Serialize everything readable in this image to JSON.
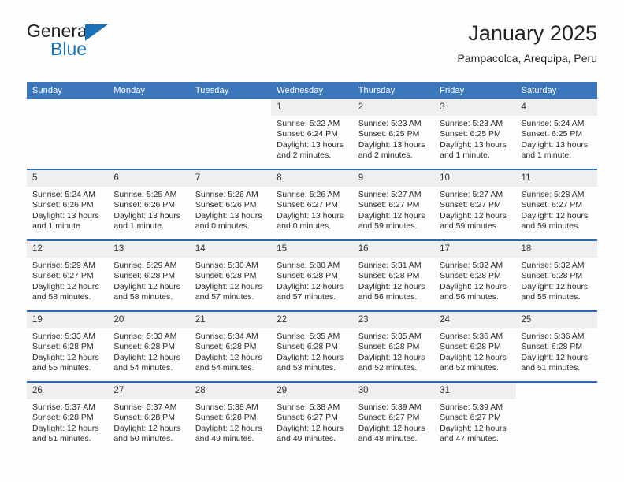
{
  "logo": {
    "word_top": "General",
    "word_bottom": "Blue",
    "accent_color": "#1a72b8"
  },
  "header": {
    "title": "January 2025",
    "subtitle": "Pampacolca, Arequipa, Peru"
  },
  "theme": {
    "header_bg": "#3c76bb",
    "row_divider": "#2c6ab0",
    "daynum_bg": "#efefef",
    "page_bg": "#fefefe"
  },
  "weekday_headers": [
    "Sunday",
    "Monday",
    "Tuesday",
    "Wednesday",
    "Thursday",
    "Friday",
    "Saturday"
  ],
  "weeks": [
    [
      {
        "day": "",
        "sunrise": "",
        "sunset": "",
        "daylight": ""
      },
      {
        "day": "",
        "sunrise": "",
        "sunset": "",
        "daylight": ""
      },
      {
        "day": "",
        "sunrise": "",
        "sunset": "",
        "daylight": ""
      },
      {
        "day": "1",
        "sunrise": "Sunrise: 5:22 AM",
        "sunset": "Sunset: 6:24 PM",
        "daylight": "Daylight: 13 hours and 2 minutes."
      },
      {
        "day": "2",
        "sunrise": "Sunrise: 5:23 AM",
        "sunset": "Sunset: 6:25 PM",
        "daylight": "Daylight: 13 hours and 2 minutes."
      },
      {
        "day": "3",
        "sunrise": "Sunrise: 5:23 AM",
        "sunset": "Sunset: 6:25 PM",
        "daylight": "Daylight: 13 hours and 1 minute."
      },
      {
        "day": "4",
        "sunrise": "Sunrise: 5:24 AM",
        "sunset": "Sunset: 6:25 PM",
        "daylight": "Daylight: 13 hours and 1 minute."
      }
    ],
    [
      {
        "day": "5",
        "sunrise": "Sunrise: 5:24 AM",
        "sunset": "Sunset: 6:26 PM",
        "daylight": "Daylight: 13 hours and 1 minute."
      },
      {
        "day": "6",
        "sunrise": "Sunrise: 5:25 AM",
        "sunset": "Sunset: 6:26 PM",
        "daylight": "Daylight: 13 hours and 1 minute."
      },
      {
        "day": "7",
        "sunrise": "Sunrise: 5:26 AM",
        "sunset": "Sunset: 6:26 PM",
        "daylight": "Daylight: 13 hours and 0 minutes."
      },
      {
        "day": "8",
        "sunrise": "Sunrise: 5:26 AM",
        "sunset": "Sunset: 6:27 PM",
        "daylight": "Daylight: 13 hours and 0 minutes."
      },
      {
        "day": "9",
        "sunrise": "Sunrise: 5:27 AM",
        "sunset": "Sunset: 6:27 PM",
        "daylight": "Daylight: 12 hours and 59 minutes."
      },
      {
        "day": "10",
        "sunrise": "Sunrise: 5:27 AM",
        "sunset": "Sunset: 6:27 PM",
        "daylight": "Daylight: 12 hours and 59 minutes."
      },
      {
        "day": "11",
        "sunrise": "Sunrise: 5:28 AM",
        "sunset": "Sunset: 6:27 PM",
        "daylight": "Daylight: 12 hours and 59 minutes."
      }
    ],
    [
      {
        "day": "12",
        "sunrise": "Sunrise: 5:29 AM",
        "sunset": "Sunset: 6:27 PM",
        "daylight": "Daylight: 12 hours and 58 minutes."
      },
      {
        "day": "13",
        "sunrise": "Sunrise: 5:29 AM",
        "sunset": "Sunset: 6:28 PM",
        "daylight": "Daylight: 12 hours and 58 minutes."
      },
      {
        "day": "14",
        "sunrise": "Sunrise: 5:30 AM",
        "sunset": "Sunset: 6:28 PM",
        "daylight": "Daylight: 12 hours and 57 minutes."
      },
      {
        "day": "15",
        "sunrise": "Sunrise: 5:30 AM",
        "sunset": "Sunset: 6:28 PM",
        "daylight": "Daylight: 12 hours and 57 minutes."
      },
      {
        "day": "16",
        "sunrise": "Sunrise: 5:31 AM",
        "sunset": "Sunset: 6:28 PM",
        "daylight": "Daylight: 12 hours and 56 minutes."
      },
      {
        "day": "17",
        "sunrise": "Sunrise: 5:32 AM",
        "sunset": "Sunset: 6:28 PM",
        "daylight": "Daylight: 12 hours and 56 minutes."
      },
      {
        "day": "18",
        "sunrise": "Sunrise: 5:32 AM",
        "sunset": "Sunset: 6:28 PM",
        "daylight": "Daylight: 12 hours and 55 minutes."
      }
    ],
    [
      {
        "day": "19",
        "sunrise": "Sunrise: 5:33 AM",
        "sunset": "Sunset: 6:28 PM",
        "daylight": "Daylight: 12 hours and 55 minutes."
      },
      {
        "day": "20",
        "sunrise": "Sunrise: 5:33 AM",
        "sunset": "Sunset: 6:28 PM",
        "daylight": "Daylight: 12 hours and 54 minutes."
      },
      {
        "day": "21",
        "sunrise": "Sunrise: 5:34 AM",
        "sunset": "Sunset: 6:28 PM",
        "daylight": "Daylight: 12 hours and 54 minutes."
      },
      {
        "day": "22",
        "sunrise": "Sunrise: 5:35 AM",
        "sunset": "Sunset: 6:28 PM",
        "daylight": "Daylight: 12 hours and 53 minutes."
      },
      {
        "day": "23",
        "sunrise": "Sunrise: 5:35 AM",
        "sunset": "Sunset: 6:28 PM",
        "daylight": "Daylight: 12 hours and 52 minutes."
      },
      {
        "day": "24",
        "sunrise": "Sunrise: 5:36 AM",
        "sunset": "Sunset: 6:28 PM",
        "daylight": "Daylight: 12 hours and 52 minutes."
      },
      {
        "day": "25",
        "sunrise": "Sunrise: 5:36 AM",
        "sunset": "Sunset: 6:28 PM",
        "daylight": "Daylight: 12 hours and 51 minutes."
      }
    ],
    [
      {
        "day": "26",
        "sunrise": "Sunrise: 5:37 AM",
        "sunset": "Sunset: 6:28 PM",
        "daylight": "Daylight: 12 hours and 51 minutes."
      },
      {
        "day": "27",
        "sunrise": "Sunrise: 5:37 AM",
        "sunset": "Sunset: 6:28 PM",
        "daylight": "Daylight: 12 hours and 50 minutes."
      },
      {
        "day": "28",
        "sunrise": "Sunrise: 5:38 AM",
        "sunset": "Sunset: 6:28 PM",
        "daylight": "Daylight: 12 hours and 49 minutes."
      },
      {
        "day": "29",
        "sunrise": "Sunrise: 5:38 AM",
        "sunset": "Sunset: 6:27 PM",
        "daylight": "Daylight: 12 hours and 49 minutes."
      },
      {
        "day": "30",
        "sunrise": "Sunrise: 5:39 AM",
        "sunset": "Sunset: 6:27 PM",
        "daylight": "Daylight: 12 hours and 48 minutes."
      },
      {
        "day": "31",
        "sunrise": "Sunrise: 5:39 AM",
        "sunset": "Sunset: 6:27 PM",
        "daylight": "Daylight: 12 hours and 47 minutes."
      },
      {
        "day": "",
        "sunrise": "",
        "sunset": "",
        "daylight": ""
      }
    ]
  ]
}
